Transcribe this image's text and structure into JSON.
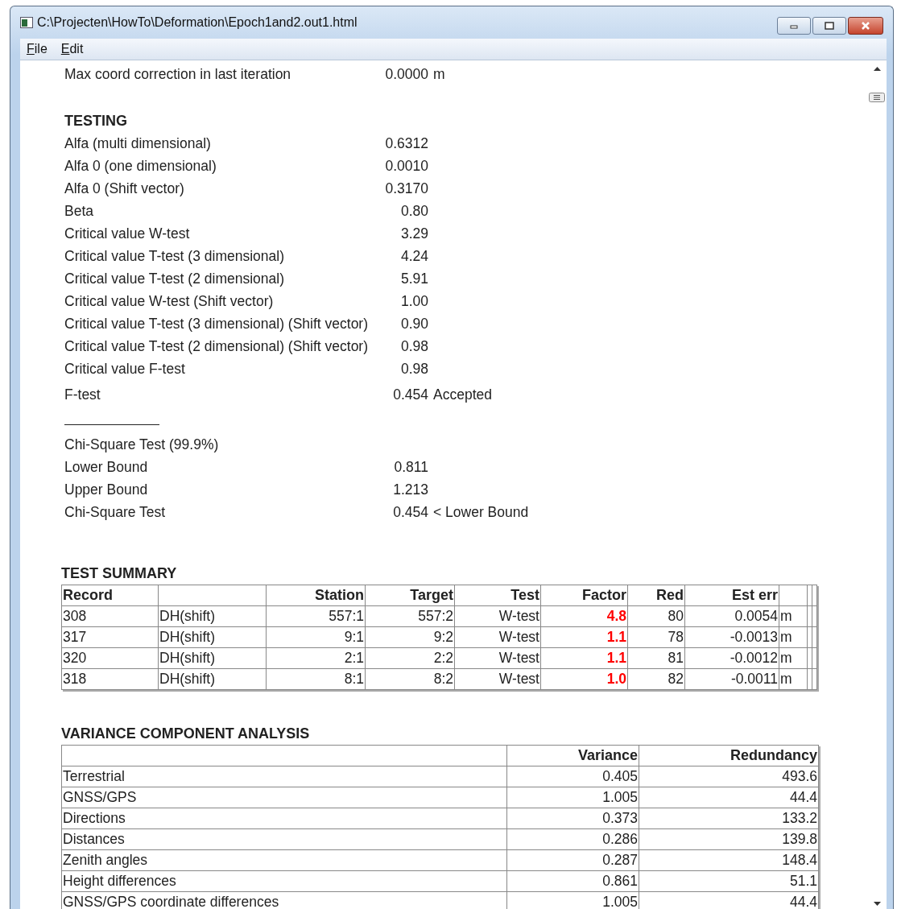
{
  "window": {
    "title": "C:\\Projecten\\HowTo\\Deformation\\Epoch1and2.out1.html"
  },
  "menu": [
    "File",
    "Edit"
  ],
  "intro": [
    {
      "label": "Max coord correction in last iteration",
      "value": "0.0000",
      "suffix": "m"
    }
  ],
  "testing": {
    "heading": "TESTING",
    "rows": [
      {
        "label": "Alfa (multi dimensional)",
        "value": "0.6312"
      },
      {
        "label": "Alfa 0 (one dimensional)",
        "value": "0.0010"
      },
      {
        "label": "Alfa 0 (Shift vector)",
        "value": "0.3170"
      },
      {
        "label": "Beta",
        "value": "0.80"
      },
      {
        "label": "Critical value W-test",
        "value": "3.29"
      },
      {
        "label": "Critical value T-test (3 dimensional)",
        "value": "4.24"
      },
      {
        "label": "Critical value T-test (2 dimensional)",
        "value": "5.91"
      },
      {
        "label": "Critical value W-test (Shift vector)",
        "value": "1.00"
      },
      {
        "label": "Critical value T-test (3 dimensional) (Shift vector)",
        "value": "0.90"
      },
      {
        "label": "Critical value T-test (2 dimensional) (Shift vector)",
        "value": "0.98"
      },
      {
        "label": "Critical value F-test",
        "value": "0.98"
      }
    ]
  },
  "f_test": {
    "label": "F-test",
    "value": "0.454",
    "suffix": "Accepted"
  },
  "chi_square": [
    {
      "label": "Chi-Square Test (99.9%)"
    },
    {
      "label": "Lower Bound",
      "value": "0.811"
    },
    {
      "label": "Upper Bound",
      "value": "1.213"
    },
    {
      "label": "Chi-Square Test",
      "value": "0.454",
      "suffix": "< Lower Bound"
    }
  ],
  "test_summary": {
    "title": "TEST SUMMARY",
    "columns": [
      "Record",
      "Station",
      "Target",
      "Test",
      "Factor",
      "Red",
      "Est err"
    ],
    "rows": [
      {
        "record": "308",
        "type": "DH(shift)",
        "station": "557:1",
        "target": "557:2",
        "test": "W-test",
        "factor": "4.8",
        "red": "80",
        "est_err": "0.0054",
        "unit": "m",
        "rejected": true
      },
      {
        "record": "317",
        "type": "DH(shift)",
        "station": "9:1",
        "target": "9:2",
        "test": "W-test",
        "factor": "1.1",
        "red": "78",
        "est_err": "-0.0013",
        "unit": "m",
        "rejected": true
      },
      {
        "record": "320",
        "type": "DH(shift)",
        "station": "2:1",
        "target": "2:2",
        "test": "W-test",
        "factor": "1.1",
        "red": "81",
        "est_err": "-0.0012",
        "unit": "m",
        "rejected": true
      },
      {
        "record": "318",
        "type": "DH(shift)",
        "station": "8:1",
        "target": "8:2",
        "test": "W-test",
        "factor": "1.0",
        "red": "82",
        "est_err": "-0.0011",
        "unit": "m",
        "rejected": true
      }
    ]
  },
  "variance": {
    "title": "VARIANCE COMPONENT ANALYSIS",
    "columns": [
      "Variance",
      "Redundancy"
    ],
    "rows": [
      {
        "component": "Terrestrial",
        "variance": "0.405",
        "redundancy": "493.6"
      },
      {
        "component": "GNSS/GPS",
        "variance": "1.005",
        "redundancy": "44.4"
      },
      {
        "component": "Directions",
        "variance": "0.373",
        "redundancy": "133.2"
      },
      {
        "component": "Distances",
        "variance": "0.286",
        "redundancy": "139.8"
      },
      {
        "component": "Zenith angles",
        "variance": "0.287",
        "redundancy": "148.4"
      },
      {
        "component": "Height differences",
        "variance": "0.861",
        "redundancy": "51.1"
      },
      {
        "component": "GNSS/GPS coordinate differences",
        "variance": "1.005",
        "redundancy": "44.4"
      }
    ]
  }
}
